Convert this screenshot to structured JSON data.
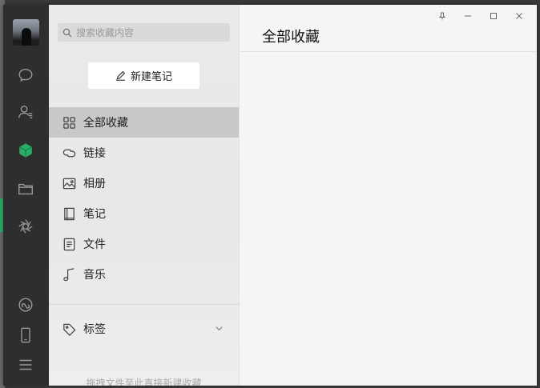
{
  "rail": {
    "icons": [
      "avatar",
      "chat-icon",
      "contacts-icon",
      "favorites-icon",
      "folder-icon",
      "moments-icon",
      "miniprogram-icon",
      "phone-icon",
      "menu-icon"
    ]
  },
  "search": {
    "placeholder": "搜索收藏内容"
  },
  "new_note": {
    "label": "新建笔记"
  },
  "menu": [
    {
      "label": "全部收藏",
      "icon": "grid-icon",
      "active": true
    },
    {
      "label": "链接",
      "icon": "link-icon",
      "active": false
    },
    {
      "label": "相册",
      "icon": "image-icon",
      "active": false
    },
    {
      "label": "笔记",
      "icon": "notebook-icon",
      "active": false
    },
    {
      "label": "文件",
      "icon": "file-icon",
      "active": false
    },
    {
      "label": "音乐",
      "icon": "music-icon",
      "active": false
    }
  ],
  "tags": {
    "label": "标签"
  },
  "hint": "拖拽文件至此直接新建收藏",
  "content": {
    "title": "全部收藏"
  },
  "colors": {
    "accent": "#2aae67",
    "rail": "#2e2e2e",
    "active_item": "#c9c8c7"
  }
}
